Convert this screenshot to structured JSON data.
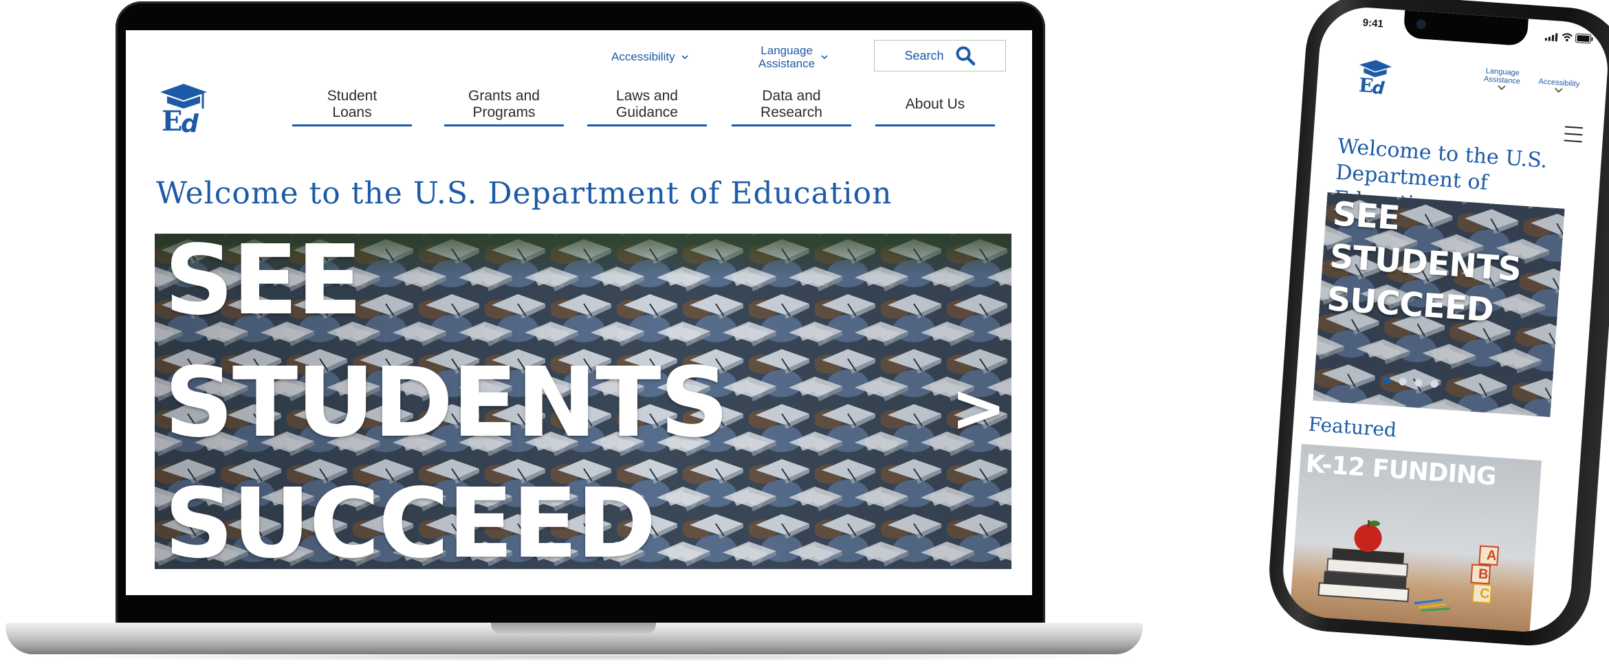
{
  "colors": {
    "brand_blue": "#1d5aa6",
    "nav_text": "#2a2a2a",
    "hero_text": "#ffffff"
  },
  "laptop": {
    "utility": {
      "accessibility": "Accessibility",
      "language_line1": "Language",
      "language_line2": "Assistance",
      "search": "Search"
    },
    "nav": [
      {
        "line1": "Student",
        "line2": "Loans"
      },
      {
        "line1": "Grants and",
        "line2": "Programs"
      },
      {
        "line1": "Laws and",
        "line2": "Guidance"
      },
      {
        "line1": "Data and",
        "line2": "Research"
      },
      {
        "line1": "About Us",
        "line2": ""
      }
    ],
    "welcome": "Welcome to the U.S. Department of Education",
    "hero": {
      "line1": "SEE",
      "line2": "STUDENTS",
      "line3": "SUCCEED",
      "next": ">"
    }
  },
  "phone": {
    "time": "9:41",
    "language_line1": "Language",
    "language_line2": "Assistance",
    "accessibility": "Accessibility",
    "welcome_line1": "Welcome to the U.S.",
    "welcome_line2": "Department of Education",
    "hero": {
      "line1": "SEE",
      "line2": "STUDENTS",
      "line3": "SUCCEED"
    },
    "carousel_dots": 4,
    "carousel_active_dot": 1,
    "featured": "Featured",
    "featured_card": "K-12 FUNDING",
    "blocks": [
      "A",
      "B",
      "C"
    ]
  },
  "icons": {
    "logo": "ed-logo-icon",
    "search": "search-icon",
    "chevron": "chevron-down-icon",
    "menu": "hamburger-menu-icon",
    "signal": "signal-icon",
    "wifi": "wifi-icon",
    "battery": "battery-icon"
  }
}
